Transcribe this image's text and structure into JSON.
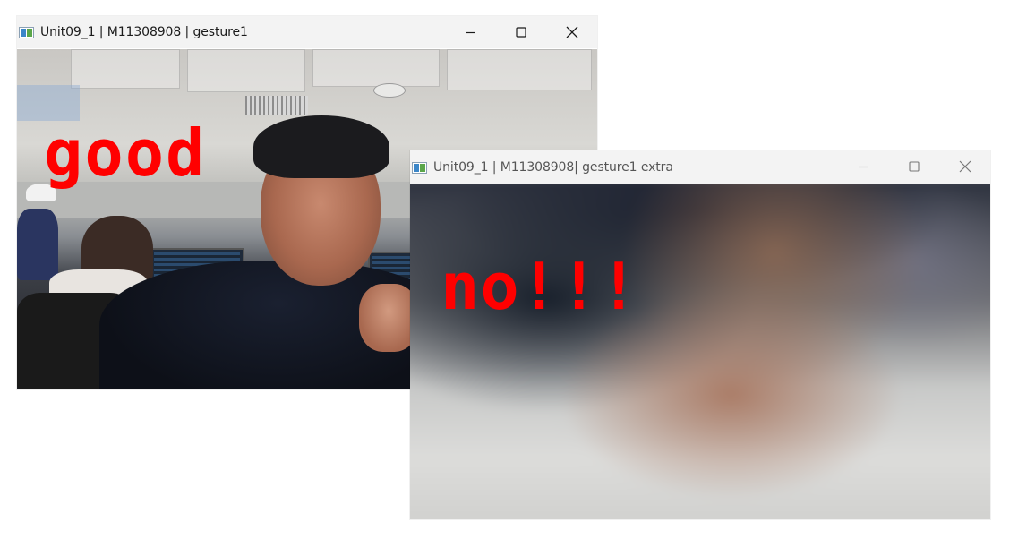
{
  "windows": [
    {
      "title": "Unit09_1 | M11308908 | gesture1",
      "overlay_text": "good",
      "controls": [
        "minimize-icon",
        "maximize-icon",
        "close-icon"
      ]
    },
    {
      "title": "Unit09_1 | M11308908| gesture1 extra",
      "overlay_text": "no!!!",
      "controls": [
        "minimize-icon",
        "maximize-icon",
        "close-icon"
      ]
    }
  ],
  "colors": {
    "overlay_text": "#ff0000",
    "titlebar_bg": "#f3f3f3",
    "active_title": "#1a1a1a",
    "inactive_title": "#555555",
    "page_bg": "#ffffff"
  }
}
